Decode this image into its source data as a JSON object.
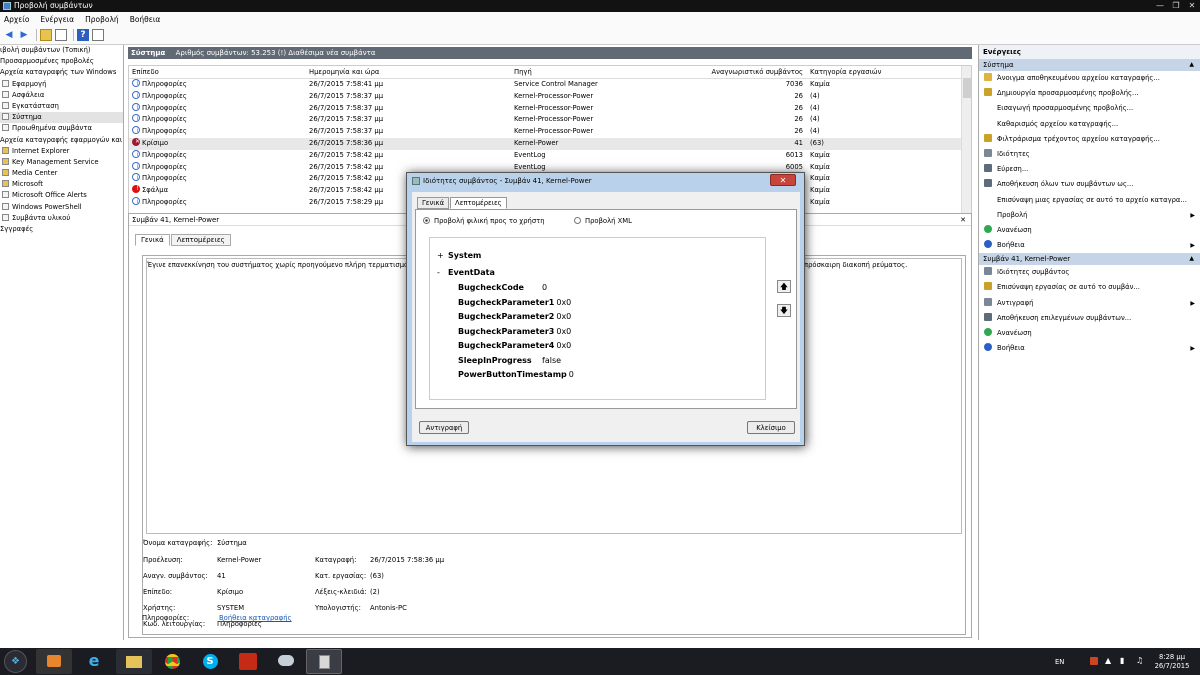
{
  "window": {
    "title": "Προβολή συμβάντων",
    "controls": [
      "—",
      "❐",
      "✕"
    ]
  },
  "menu": [
    "Αρχείο",
    "Ενέργεια",
    "Προβολή",
    "Βοήθεια"
  ],
  "toolbar_icons": [
    "back-arrow",
    "forward-arrow",
    "up-folder",
    "console-tree",
    "help",
    "properties"
  ],
  "tree": [
    {
      "label": "ιβολή συμβάντων (Τοπική)",
      "indent": 0
    },
    {
      "label": "Προσαρμοσμένες προβολές",
      "indent": 0
    },
    {
      "label": "Αρχεία καταγραφής των Windows",
      "indent": 0
    },
    {
      "label": "Εφαρμογή",
      "indent": 1
    },
    {
      "label": "Ασφάλεια",
      "indent": 1
    },
    {
      "label": "Εγκατάσταση",
      "indent": 1
    },
    {
      "label": "Σύστημα",
      "indent": 1,
      "selected": true
    },
    {
      "label": "Προωθημένα συμβάντα",
      "indent": 1
    },
    {
      "label": "Αρχεία καταγραφής εφαρμογών και",
      "indent": 0
    },
    {
      "label": "Internet Explorer",
      "indent": 1
    },
    {
      "label": "Key Management Service",
      "indent": 1
    },
    {
      "label": "Media Center",
      "indent": 1
    },
    {
      "label": "Microsoft",
      "indent": 1
    },
    {
      "label": "Microsoft Office Alerts",
      "indent": 1
    },
    {
      "label": "Windows PowerShell",
      "indent": 1
    },
    {
      "label": "Συμβάντα υλικού",
      "indent": 1
    },
    {
      "label": "Σγγραφές",
      "indent": 0
    }
  ],
  "center": {
    "title": "Σύστημα",
    "subtitle": "Αριθμός συμβάντων: 53.253 (!) Διαθέσιμα νέα συμβάντα",
    "columns": [
      "Επίπεδο",
      "Ημερομηνία και ώρα",
      "Πηγή",
      "Αναγνωριστικό συμβάντος",
      "Κατηγορία εργασιών"
    ],
    "rows": [
      {
        "level": "Πληροφορίες",
        "type": "info",
        "date": "26/7/2015 7:58:41 μμ",
        "source": "Service Control Manager",
        "id": "7036",
        "cat": "Καμία"
      },
      {
        "level": "Πληροφορίες",
        "type": "info",
        "date": "26/7/2015 7:58:37 μμ",
        "source": "Kernel-Processor-Power",
        "id": "26",
        "cat": "(4)"
      },
      {
        "level": "Πληροφορίες",
        "type": "info",
        "date": "26/7/2015 7:58:37 μμ",
        "source": "Kernel-Processor-Power",
        "id": "26",
        "cat": "(4)"
      },
      {
        "level": "Πληροφορίες",
        "type": "info",
        "date": "26/7/2015 7:58:37 μμ",
        "source": "Kernel-Processor-Power",
        "id": "26",
        "cat": "(4)"
      },
      {
        "level": "Πληροφορίες",
        "type": "info",
        "date": "26/7/2015 7:58:37 μμ",
        "source": "Kernel-Processor-Power",
        "id": "26",
        "cat": "(4)"
      },
      {
        "level": "Κρίσιμο",
        "type": "crit",
        "date": "26/7/2015 7:58:36 μμ",
        "source": "Kernel-Power",
        "id": "41",
        "cat": "(63)",
        "selected": true
      },
      {
        "level": "Πληροφορίες",
        "type": "info",
        "date": "26/7/2015 7:58:42 μμ",
        "source": "EventLog",
        "id": "6013",
        "cat": "Καμία"
      },
      {
        "level": "Πληροφορίες",
        "type": "info",
        "date": "26/7/2015 7:58:42 μμ",
        "source": "EventLog",
        "id": "6005",
        "cat": "Καμία"
      },
      {
        "level": "Πληροφορίες",
        "type": "info",
        "date": "26/7/2015 7:58:42 μμ",
        "source": "",
        "id": "",
        "cat": "Καμία"
      },
      {
        "level": "Σφάλμα",
        "type": "err",
        "date": "26/7/2015 7:58:42 μμ",
        "source": "",
        "id": "",
        "cat": "Καμία"
      },
      {
        "level": "Πληροφορίες",
        "type": "info",
        "date": "26/7/2015 7:58:29 μμ",
        "source": "",
        "id": "",
        "cat": "Καμία"
      }
    ]
  },
  "details": {
    "title": "Συμβάν 41, Kernel-Power",
    "tabs": [
      "Γενικά",
      "Λεπτομέρειες"
    ],
    "message": "Έγινε επανεκκίνηση του συστήματος χωρίς προηγούμενο πλήρη τερματισμό.",
    "message_tail": "πρόσκαιρη διακοπή ρεύματος.",
    "fields": {
      "log_name_label": "Όνομα καταγραφής:",
      "log_name": "Σύστημα",
      "source_label": "Προέλευση:",
      "source": "Kernel-Power",
      "recorded_label": "Καταγραφή:",
      "recorded": "26/7/2015 7:58:36 μμ",
      "event_id_label": "Αναγν. συμβάντος:",
      "event_id": "41",
      "task_label": "Κατ. εργασίας:",
      "task": "(63)",
      "level_label": "Επίπεδο:",
      "level": "Κρίσιμο",
      "keywords_label": "Λέξεις-κλειδιά:",
      "keywords": "(2)",
      "user_label": "Χρήστης:",
      "user": "SYSTEM",
      "computer_label": "Υπολογιστής:",
      "computer": "Antonis-PC",
      "opcode_label": "Κωδ. λειτουργίας:",
      "opcode": "Πληροφορίες",
      "info_label": "Πληροφορίες:",
      "info_link": "Βοήθεια καταγραφής"
    }
  },
  "actions": {
    "header": "Ενέργειες",
    "section1": "Σύστημα",
    "items1": [
      {
        "label": "Άνοιγμα αποθηκευμένου αρχείου καταγραφής...",
        "icon": "open-log-icon"
      },
      {
        "label": "Δημιουργία προσαρμοσμένης προβολής...",
        "icon": "filter-icon"
      },
      {
        "label": "Εισαγωγή προσαρμοσμένης προβολής...",
        "icon": ""
      },
      {
        "label": "Καθαρισμός αρχείου καταγραφής...",
        "icon": ""
      },
      {
        "label": "Φιλτράρισμα τρέχοντος αρχείου καταγραφής...",
        "icon": "filter-icon"
      },
      {
        "label": "Ιδιότητες",
        "icon": "properties-icon"
      },
      {
        "label": "Εύρεση...",
        "icon": "find-icon"
      },
      {
        "label": "Αποθήκευση όλων των συμβάντων ως...",
        "icon": "save-icon"
      },
      {
        "label": "Επισύναψη μιας εργασίας σε αυτό το αρχείο καταγρα...",
        "icon": ""
      },
      {
        "label": "Προβολή",
        "icon": "",
        "submenu": true
      },
      {
        "label": "Ανανέωση",
        "icon": "refresh-icon"
      },
      {
        "label": "Βοήθεια",
        "icon": "help-icon",
        "submenu": true
      }
    ],
    "section2": "Συμβάν 41, Kernel-Power",
    "items2": [
      {
        "label": "Ιδιότητες συμβάντος",
        "icon": "properties-icon"
      },
      {
        "label": "Επισύναψη εργασίας σε αυτό το συμβάν...",
        "icon": "task-icon"
      },
      {
        "label": "Αντιγραφή",
        "icon": "copy-icon",
        "submenu": true
      },
      {
        "label": "Αποθήκευση επιλεγμένων συμβάντων...",
        "icon": "save-icon"
      },
      {
        "label": "Ανανέωση",
        "icon": "refresh-icon"
      },
      {
        "label": "Βοήθεια",
        "icon": "help-icon",
        "submenu": true
      }
    ]
  },
  "dialog": {
    "title": "Ιδιότητες συμβάντος - Συμβάν 41, Kernel-Power",
    "tabs": [
      "Γενικά",
      "Λεπτομέρειες"
    ],
    "radio_friendly": "Προβολή φιλική προς το χρήστη",
    "radio_xml": "Προβολή XML",
    "system_label": "System",
    "eventdata_label": "EventData",
    "expand_plus": "+",
    "expand_minus": "-",
    "fields": [
      {
        "name": "BugcheckCode",
        "value": "0"
      },
      {
        "name": "BugcheckParameter1",
        "value": "0x0"
      },
      {
        "name": "BugcheckParameter2",
        "value": "0x0"
      },
      {
        "name": "BugcheckParameter3",
        "value": "0x0"
      },
      {
        "name": "BugcheckParameter4",
        "value": "0x0"
      },
      {
        "name": "SleepInProgress",
        "value": "false"
      },
      {
        "name": "PowerButtonTimestamp",
        "value": "0"
      }
    ],
    "copy_button": "Αντιγραφή",
    "close_button": "Κλείσιμο"
  },
  "taskbar": {
    "apps": [
      "media-player-icon",
      "internet-explorer-icon",
      "file-explorer-icon",
      "chrome-icon",
      "skype-icon",
      "game-icon",
      "weather-icon",
      "event-viewer-icon"
    ],
    "lang": "EN",
    "time": "8:28 μμ",
    "date": "26/7/2015"
  },
  "colors": {
    "accent": "#616a74",
    "dialog_frame": "#b9d1ea",
    "section": "#c5d4e6",
    "critical": "#9b1b30",
    "error": "#d11111",
    "link": "#1a57b5"
  }
}
